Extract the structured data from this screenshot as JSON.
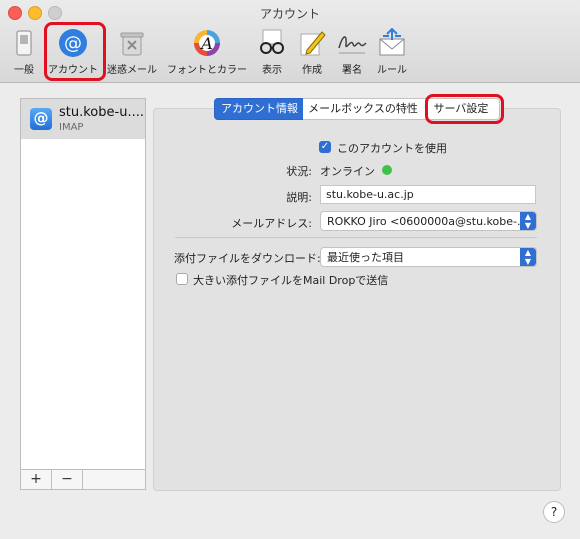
{
  "window": {
    "title": "アカウント"
  },
  "toolbar": {
    "items": [
      {
        "label": "一般"
      },
      {
        "label": "アカウント"
      },
      {
        "label": "迷惑メール"
      },
      {
        "label": "フォントとカラー"
      },
      {
        "label": "表示"
      },
      {
        "label": "作成"
      },
      {
        "label": "署名"
      },
      {
        "label": "ルール"
      }
    ]
  },
  "accounts": [
    {
      "name": "stu.kobe-u....",
      "type": "IMAP",
      "icon": "@"
    }
  ],
  "list_buttons": {
    "add": "+",
    "remove": "−"
  },
  "tabs": [
    {
      "label": "アカウント情報",
      "selected": true
    },
    {
      "label": "メールボックスの特性",
      "selected": false
    },
    {
      "label": "サーバ設定",
      "selected": false
    }
  ],
  "form": {
    "enable_label": "このアカウントを使用",
    "enable_checked": true,
    "status_label": "状況:",
    "status_value": "オンライン",
    "description_label": "説明:",
    "description_value": "stu.kobe-u.ac.jp",
    "email_label": "メールアドレス:",
    "email_value": "ROKKO Jiro <0600000a@stu.kobe-...",
    "download_label": "添付ファイルをダウンロード:",
    "download_value": "最近使った項目",
    "maildrop_label": "大きい添付ファイルをMail Dropで送信",
    "maildrop_checked": false
  },
  "help": "?",
  "colors": {
    "accent": "#2f6ed3",
    "highlight": "#e01020",
    "online": "#40c24a"
  }
}
